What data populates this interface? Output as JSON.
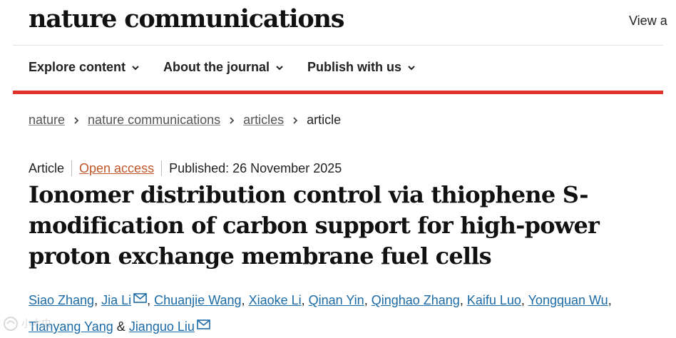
{
  "header": {
    "logo": "nature communications",
    "view_link": "View a"
  },
  "nav": {
    "items": [
      {
        "label": "Explore content"
      },
      {
        "label": "About the journal"
      },
      {
        "label": "Publish with us"
      }
    ]
  },
  "breadcrumb": {
    "items": [
      "nature",
      "nature communications",
      "articles"
    ],
    "current": "article"
  },
  "meta": {
    "type": "Article",
    "access": "Open access",
    "published": "Published: 26 November 2025"
  },
  "article": {
    "title": "Ionomer distribution control via thiophene S-modification of carbon support for high-power proton exchange membrane fuel cells"
  },
  "authors": [
    "Siao Zhang",
    "Jia Li",
    "Chuanjie Wang",
    "Xiaoke Li",
    "Qinan Yin",
    "Qinghao Zhang",
    "Kaifu Luo",
    "Yongquan Wu",
    "Tianyang Yang",
    "Jianguo Liu"
  ],
  "authors_conjunction": "&",
  "watermark": "小木虫",
  "colors": {
    "accent_red": "#e0342a",
    "link_blue": "#1b6aa5",
    "open_access": "#c2562b"
  },
  "icons": {
    "nav_dropdown": "chevron-down-icon",
    "breadcrumb_separator": "chevron-right-icon",
    "corresponding_author": "mail-icon"
  }
}
